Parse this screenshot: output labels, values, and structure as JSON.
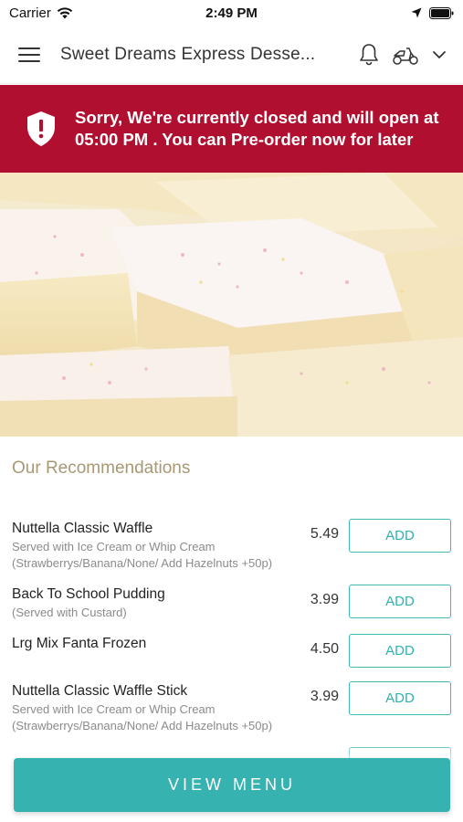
{
  "status_bar": {
    "carrier": "Carrier",
    "time": "2:49 PM"
  },
  "header": {
    "title": "Sweet Dreams Express Desse...",
    "icons": [
      "menu-icon",
      "bell-icon",
      "delivery-scooter-icon",
      "chevron-down-icon"
    ]
  },
  "closed_banner": {
    "message": "Sorry, We're currently closed and will open at 05:00 PM . You can Pre-order now for later",
    "color": "#b10f30"
  },
  "recommendations": {
    "title": "Our Recommendations",
    "items": [
      {
        "name": "Nuttella Classic Waffle",
        "description": "Served with Ice Cream or Whip Cream (Strawberrys/Banana/None/ Add Hazelnuts +50p)",
        "price": "5.49",
        "button": "ADD"
      },
      {
        "name": "Back To School Pudding",
        "description": "(Served with Custard)",
        "price": "3.99",
        "button": "ADD"
      },
      {
        "name": "Lrg Mix Fanta Frozen",
        "description": "",
        "price": "4.50",
        "button": "ADD"
      },
      {
        "name": "Nuttella Classic Waffle Stick",
        "description": "Served with Ice Cream or Whip Cream (Strawberrys/Banana/None/ Add Hazelnuts +50p)",
        "price": "3.99",
        "button": "ADD"
      }
    ]
  },
  "view_menu_label": "VIEW MENU",
  "colors": {
    "accent": "#36b3b1",
    "banner": "#b10f30",
    "section_title": "#a89874"
  }
}
